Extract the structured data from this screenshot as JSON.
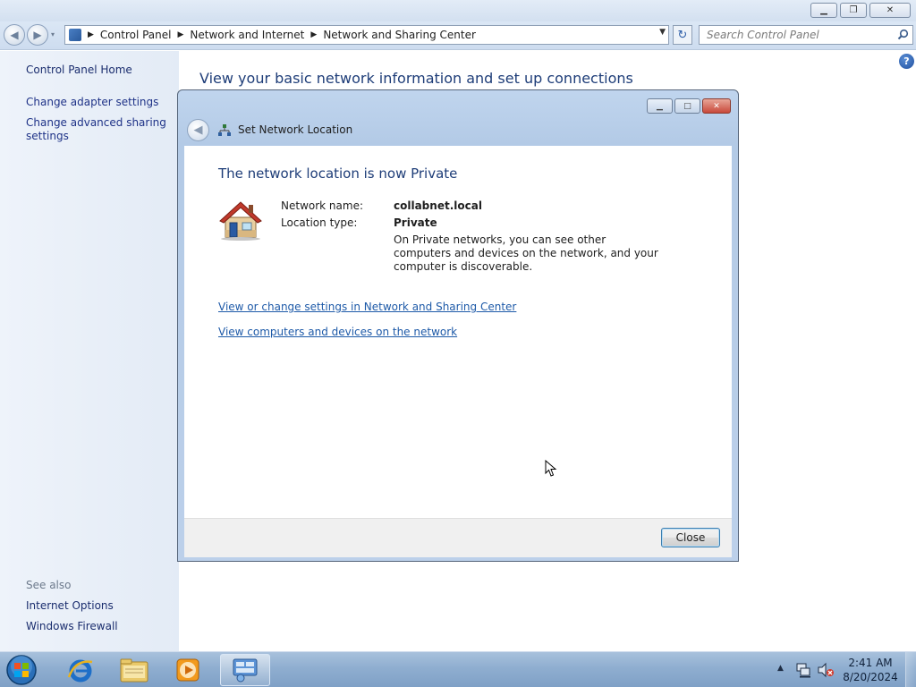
{
  "explorer": {
    "breadcrumbs": [
      "Control Panel",
      "Network and Internet",
      "Network and Sharing Center"
    ],
    "search_placeholder": "Search Control Panel",
    "main_title": "View your basic network information and set up connections"
  },
  "left_pane": {
    "home": "Control Panel Home",
    "links": [
      "Change adapter settings",
      "Change advanced sharing settings"
    ],
    "see_also_label": "See also",
    "see_also": [
      "Internet Options",
      "Windows Firewall"
    ]
  },
  "dialog": {
    "title": "Set Network Location",
    "heading": "The network location is now Private",
    "network_name_label": "Network name:",
    "network_name": "collabnet.local",
    "location_type_label": "Location type:",
    "location_type": "Private",
    "description": "On Private networks, you can see other computers and devices on the network, and your computer is discoverable.",
    "links": [
      "View or change settings in Network and Sharing Center",
      "View computers and devices on the network"
    ],
    "close_button": "Close"
  },
  "taskbar": {
    "pinned": [
      "start-orb",
      "internet-explorer-icon",
      "windows-explorer-icon",
      "media-player-icon",
      "control-panel-icon"
    ],
    "clock": {
      "time": "2:41 AM",
      "date": "8/20/2024"
    }
  },
  "colors": {
    "accent_link": "#1e5aa8",
    "heading_blue": "#1e3d78",
    "close_button_red": "#c8483a"
  }
}
